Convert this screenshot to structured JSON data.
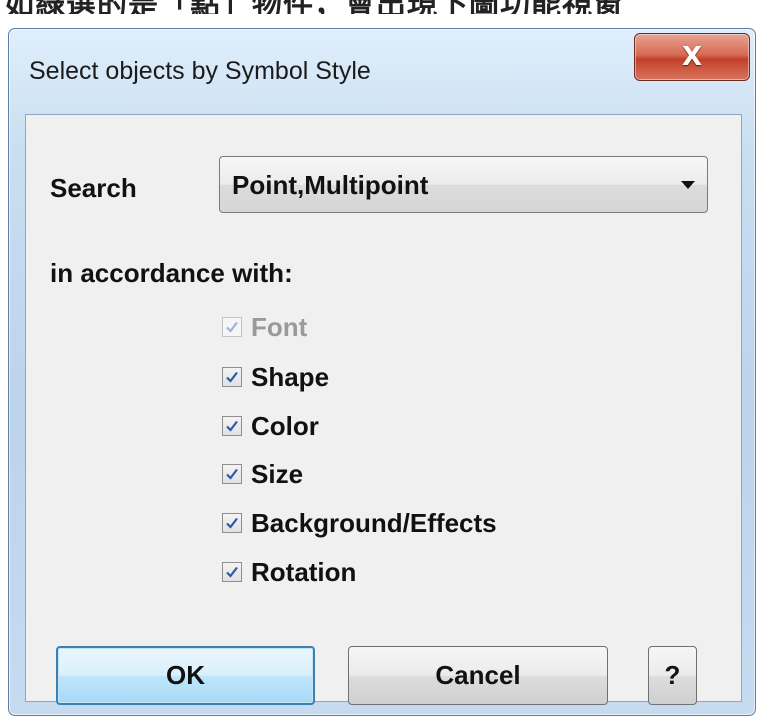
{
  "window": {
    "title": "Select objects by Symbol Style",
    "close_label": "X"
  },
  "header_strip_text": "如綠選的是「點」物件，會出現下圖功能視窗",
  "search": {
    "label": "Search",
    "selected_value": "Point,Multipoint"
  },
  "criteria": {
    "heading": "in accordance with:",
    "items": [
      {
        "label": "Font",
        "checked": true,
        "enabled": false
      },
      {
        "label": "Shape",
        "checked": true,
        "enabled": true
      },
      {
        "label": "Color",
        "checked": true,
        "enabled": true
      },
      {
        "label": "Size",
        "checked": true,
        "enabled": true
      },
      {
        "label": "Background/Effects",
        "checked": true,
        "enabled": true
      },
      {
        "label": "Rotation",
        "checked": true,
        "enabled": true
      }
    ]
  },
  "buttons": {
    "ok": "OK",
    "cancel": "Cancel",
    "help": "?"
  },
  "colors": {
    "default_button_border": "#3c7fb1",
    "close_button": "#c2412a",
    "check_mark": "#2a5aa8",
    "disabled_check_mark": "#9db4d6"
  }
}
